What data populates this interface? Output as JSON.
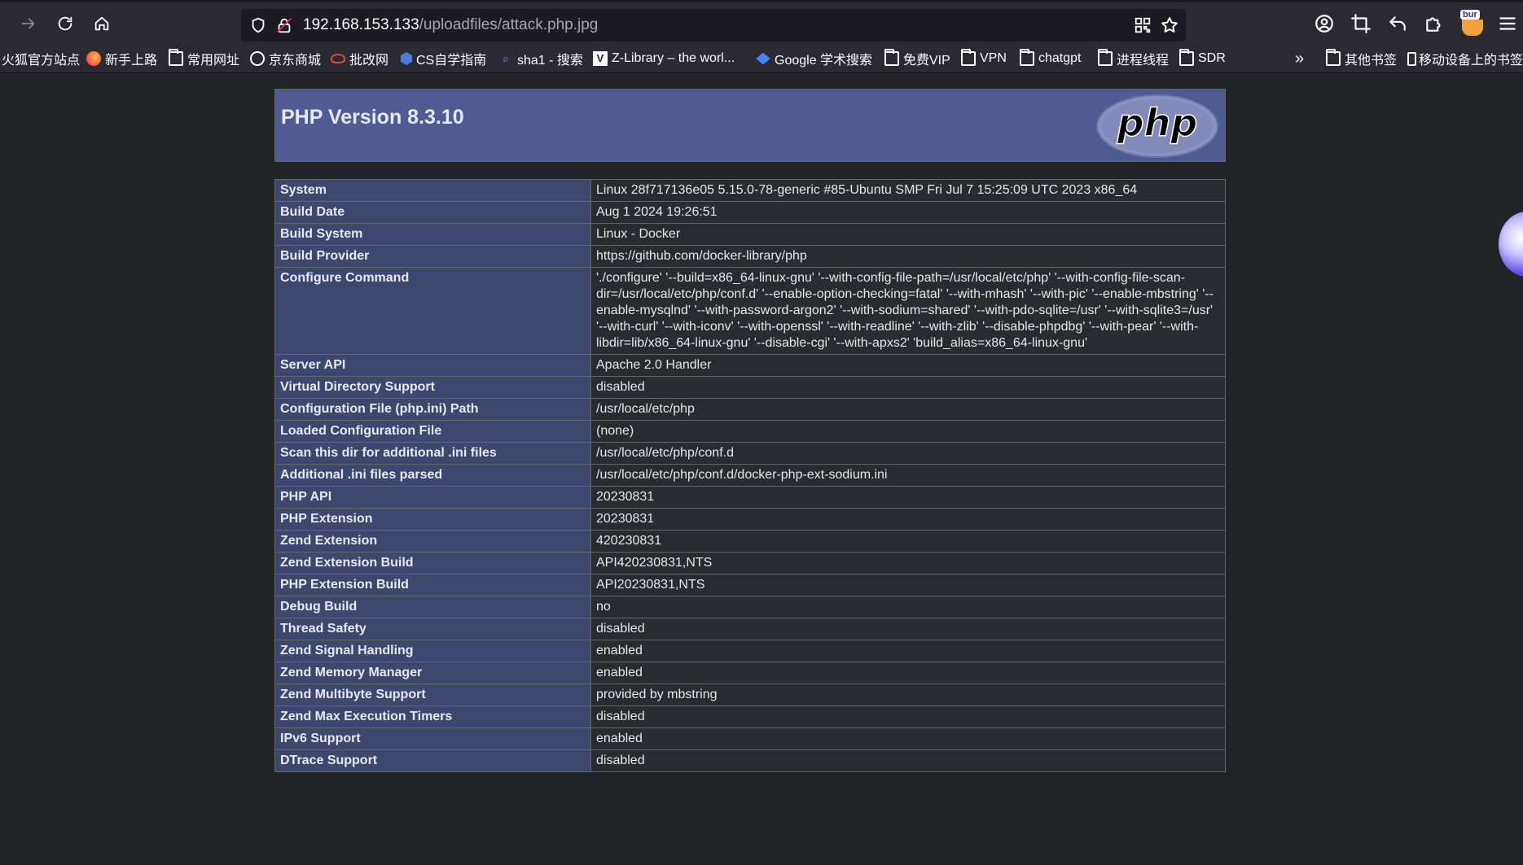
{
  "browser": {
    "url_host": "192.168.153.133",
    "url_path": "/uploadfiles/attack.php.jpg",
    "profile_badge": "bur",
    "bookmarks": [
      {
        "label": "火狐官方站点",
        "icon": "none"
      },
      {
        "label": "新手上路",
        "icon": "firefox-icon"
      },
      {
        "label": "常用网址",
        "icon": "folder-icon"
      },
      {
        "label": "京东商城",
        "icon": "globe-icon"
      },
      {
        "label": "批改网",
        "icon": "site-icon"
      },
      {
        "label": "CS自学指南",
        "icon": "site-icon"
      },
      {
        "label": "sha1 - 搜索",
        "icon": "search-icon"
      },
      {
        "label": "Z-Library – the worl...",
        "icon": "zlib-icon"
      },
      {
        "label": "Google 学术搜索",
        "icon": "scholar-icon"
      },
      {
        "label": "免费VIP",
        "icon": "folder-icon"
      },
      {
        "label": "VPN",
        "icon": "folder-icon"
      },
      {
        "label": "chatgpt",
        "icon": "folder-icon"
      },
      {
        "label": "进程线程",
        "icon": "folder-icon"
      },
      {
        "label": "SDR",
        "icon": "folder-icon"
      }
    ],
    "other_bookmarks": "其他书签",
    "mobile_bookmarks": "移动设备上的书签"
  },
  "phpinfo": {
    "title": "PHP Version 8.3.10",
    "logo_text": "php",
    "rows": [
      {
        "key": "System",
        "value": "Linux 28f717136e05 5.15.0-78-generic #85-Ubuntu SMP Fri Jul 7 15:25:09 UTC 2023 x86_64"
      },
      {
        "key": "Build Date",
        "value": "Aug 1 2024 19:26:51"
      },
      {
        "key": "Build System",
        "value": "Linux - Docker"
      },
      {
        "key": "Build Provider",
        "value": "https://github.com/docker-library/php"
      },
      {
        "key": "Configure Command",
        "value": "'./configure' '--build=x86_64-linux-gnu' '--with-config-file-path=/usr/local/etc/php' '--with-config-file-scan-dir=/usr/local/etc/php/conf.d' '--enable-option-checking=fatal' '--with-mhash' '--with-pic' '--enable-mbstring' '--enable-mysqlnd' '--with-password-argon2' '--with-sodium=shared' '--with-pdo-sqlite=/usr' '--with-sqlite3=/usr' '--with-curl' '--with-iconv' '--with-openssl' '--with-readline' '--with-zlib' '--disable-phpdbg' '--with-pear' '--with-libdir=lib/x86_64-linux-gnu' '--disable-cgi' '--with-apxs2' 'build_alias=x86_64-linux-gnu'"
      },
      {
        "key": "Server API",
        "value": "Apache 2.0 Handler"
      },
      {
        "key": "Virtual Directory Support",
        "value": "disabled"
      },
      {
        "key": "Configuration File (php.ini) Path",
        "value": "/usr/local/etc/php"
      },
      {
        "key": "Loaded Configuration File",
        "value": "(none)"
      },
      {
        "key": "Scan this dir for additional .ini files",
        "value": "/usr/local/etc/php/conf.d"
      },
      {
        "key": "Additional .ini files parsed",
        "value": "/usr/local/etc/php/conf.d/docker-php-ext-sodium.ini"
      },
      {
        "key": "PHP API",
        "value": "20230831"
      },
      {
        "key": "PHP Extension",
        "value": "20230831"
      },
      {
        "key": "Zend Extension",
        "value": "420230831"
      },
      {
        "key": "Zend Extension Build",
        "value": "API420230831,NTS"
      },
      {
        "key": "PHP Extension Build",
        "value": "API20230831,NTS"
      },
      {
        "key": "Debug Build",
        "value": "no"
      },
      {
        "key": "Thread Safety",
        "value": "disabled"
      },
      {
        "key": "Zend Signal Handling",
        "value": "enabled"
      },
      {
        "key": "Zend Memory Manager",
        "value": "enabled"
      },
      {
        "key": "Zend Multibyte Support",
        "value": "provided by mbstring"
      },
      {
        "key": "Zend Max Execution Timers",
        "value": "disabled"
      },
      {
        "key": "IPv6 Support",
        "value": "enabled"
      },
      {
        "key": "DTrace Support",
        "value": "disabled"
      }
    ]
  },
  "colors": {
    "header_bg": "#4f5b93",
    "key_bg": "#3e476e",
    "value_bg": "#2a2b30",
    "page_bg": "#222327"
  }
}
